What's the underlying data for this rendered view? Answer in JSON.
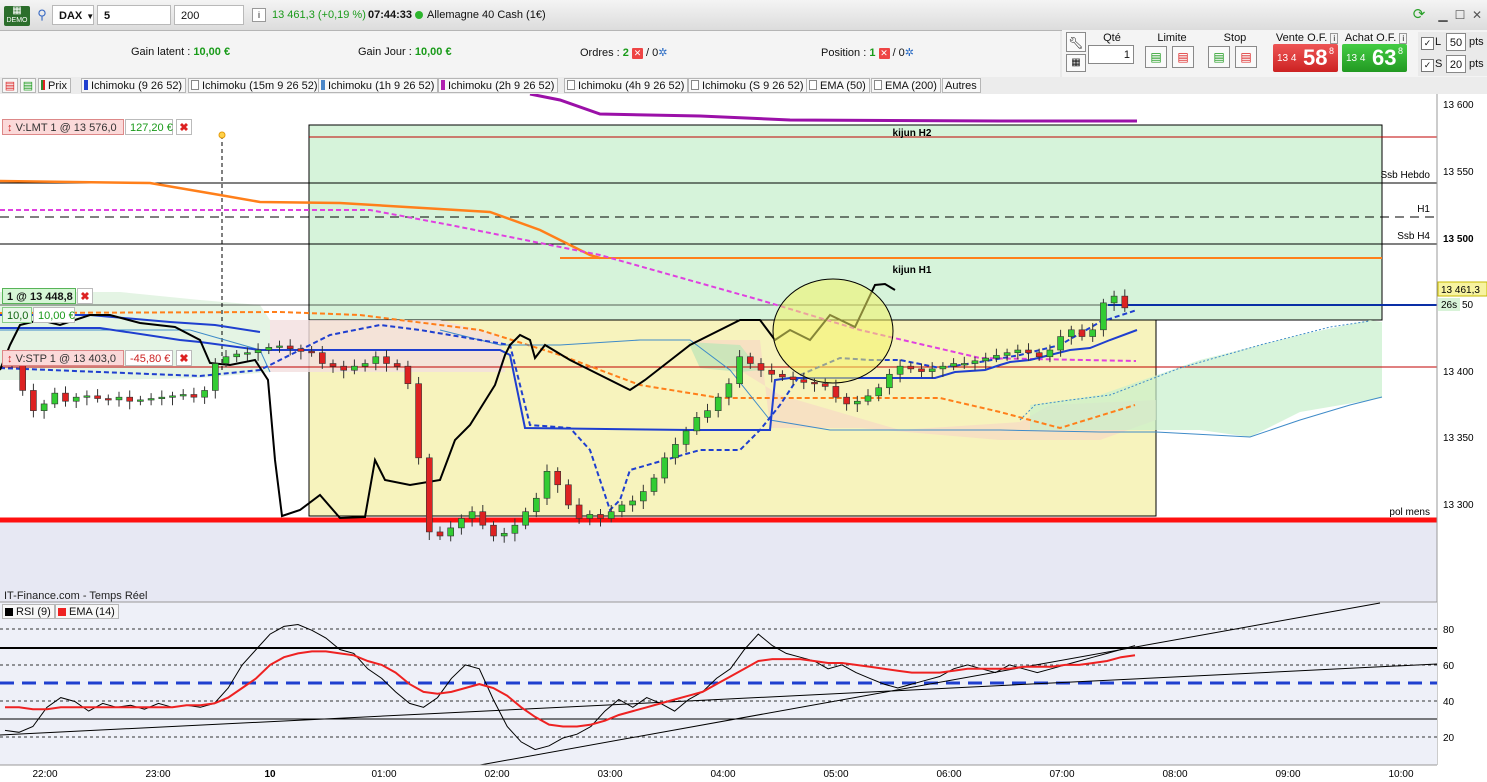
{
  "toolbar": {
    "demo_label": "DEMO",
    "symbol": "DAX",
    "timeframe": "5 minutes",
    "units": "200 unités",
    "info_icon": "i",
    "quote": "13 461,3 (+0,19 %)",
    "time": "07:44:33",
    "instrument": "Allemagne 40 Cash (1€)"
  },
  "info": {
    "gain_latent_label": "Gain latent :",
    "gain_latent_value": "10,00 €",
    "gain_jour_label": "Gain Jour :",
    "gain_jour_value": "10,00 €",
    "ordres_label": "Ordres :",
    "ordres_count": "2",
    "ordres_zero": "/ 0",
    "position_label": "Position :",
    "position_count": "1",
    "position_zero": "/ 0"
  },
  "order_panel": {
    "qty_label": "Qté",
    "qty_value": "1",
    "limite_label": "Limite",
    "stop_label": "Stop",
    "vente_label": "Vente O.F.",
    "achat_label": "Achat O.F.",
    "vente_prefix": "13 4",
    "vente_big": "58",
    "vente_sup": "8",
    "achat_prefix": "13 4",
    "achat_big": "63",
    "achat_sup": "8",
    "l_label": "L",
    "l_value": "50",
    "s_label": "S",
    "s_value": "20",
    "pts1": "pts",
    "pts2": "pts"
  },
  "indicators": [
    {
      "label": "Prix",
      "color": "#2e8b2e"
    },
    {
      "label": "Ichimoku (9 26 52)",
      "color": "#1f3fcf"
    },
    {
      "label": "Ichimoku (15m 9 26 52)",
      "color": "#ffffff"
    },
    {
      "label": "Ichimoku (1h 9 26 52)",
      "color": "#4a86c8"
    },
    {
      "label": "Ichimoku (2h 9 26 52)",
      "color": "#b020b0"
    },
    {
      "label": "Ichimoku (4h 9 26 52)",
      "color": "#ffffff"
    },
    {
      "label": "Ichimoku (S 9 26 52)",
      "color": "#ffffff"
    },
    {
      "label": "EMA (50)",
      "color": "#ffffff"
    },
    {
      "label": "EMA (200)",
      "color": "#ffffff"
    },
    {
      "label": "Autres",
      "color": "none"
    }
  ],
  "orders": {
    "limit_tag": "V:LMT  1 @ 13 576,0",
    "limit_pnl": "127,20 €",
    "position_tag": "1 @ 13 448,8",
    "position_qty": "10,0",
    "position_pnl": "10,00 €",
    "stop_tag": "V:STP  1 @ 13 403,0",
    "stop_pnl": "-45,80 €"
  },
  "annotations": {
    "kijun_h2": "kijun H2",
    "kijun_h1": "kijun H1",
    "ssb_hebdo": "Ssb Hebdo",
    "h1": "H1",
    "ssb_h4": "Ssb H4",
    "pol_mens": "pol mens",
    "last_price": "13 461,3",
    "countdown": "26s"
  },
  "price_axis": [
    "13 600",
    "13 550",
    "13 500",
    "50",
    "13 400",
    "13 350",
    "13 300"
  ],
  "time_axis": [
    "22:00",
    "23:00",
    "10",
    "01:00",
    "02:00",
    "03:00",
    "04:00",
    "05:00",
    "06:00",
    "07:00",
    "08:00",
    "09:00",
    "10:00"
  ],
  "rsi_panel": {
    "source": "IT-Finance.com - Temps Réel",
    "rsi_label": "RSI (9)",
    "ema_label": "EMA (14)",
    "axis": [
      "80",
      "60",
      "40",
      "20"
    ]
  },
  "colors": {
    "candle_up": "#33cc33",
    "candle_down": "#dd2222",
    "tenkan": "#1f3fcf",
    "kijun_h4": "#ff7f1a",
    "ema_magenta": "#e040e0",
    "chikou": "#000000",
    "pol_mens": "#ff1010"
  },
  "chart_data": {
    "type": "candlestick",
    "symbol": "DAX",
    "timeframe": "5 minutes",
    "last": 13461.3,
    "change_pct": 0.19,
    "y_range": [
      13270,
      13620
    ],
    "levels": {
      "kijun_h2": 13576,
      "ssb_hebdo": 13543,
      "h1": 13516,
      "ssb_h4": 13494,
      "kijun_h1": 13485,
      "position": 13448.8,
      "stop": 13403,
      "pol_mens": 13288
    },
    "closes": [
      13420,
      13400,
      13385,
      13390,
      13398,
      13392,
      13395,
      13396,
      13394,
      13393,
      13395,
      13392,
      13393,
      13394,
      13395,
      13396,
      13397,
      13395,
      13400,
      13420,
      13425,
      13427,
      13428,
      13430,
      13432,
      13433,
      13431,
      13429,
      13428,
      13420,
      13418,
      13415,
      13418,
      13420,
      13425,
      13420,
      13418,
      13405,
      13350,
      13295,
      13292,
      13298,
      13305,
      13310,
      13300,
      13292,
      13294,
      13300,
      13310,
      13320,
      13340,
      13330,
      13315,
      13305,
      13308,
      13305,
      13310,
      13315,
      13318,
      13325,
      13335,
      13350,
      13360,
      13370,
      13380,
      13385,
      13395,
      13405,
      13425,
      13420,
      13415,
      13412,
      13410,
      13408,
      13406,
      13405,
      13403,
      13395,
      13390,
      13392,
      13396,
      13402,
      13412,
      13418,
      13416,
      13414,
      13416,
      13418,
      13420,
      13420,
      13422,
      13424,
      13426,
      13428,
      13430,
      13428,
      13425,
      13430,
      13440,
      13445,
      13440,
      13445,
      13465,
      13470,
      13461.3
    ]
  },
  "rsi_data": {
    "type": "line",
    "y_range": [
      10,
      90
    ],
    "rsi": [
      28,
      27,
      30,
      40,
      45,
      43,
      38,
      42,
      40,
      41,
      39,
      42,
      40,
      41,
      40,
      42,
      50,
      62,
      70,
      78,
      82,
      83,
      80,
      76,
      70,
      68,
      60,
      55,
      48,
      42,
      40,
      45,
      55,
      62,
      60,
      44,
      30,
      22,
      18,
      20,
      24,
      26,
      30,
      38,
      44,
      40,
      45,
      42,
      38,
      44,
      48,
      55,
      60,
      70,
      78,
      72,
      68,
      66,
      64,
      60,
      62,
      58,
      55,
      52,
      50,
      52,
      54,
      56,
      60,
      62,
      60,
      58,
      62,
      60,
      58,
      60,
      62,
      64,
      66,
      68,
      70,
      72
    ],
    "ema": [
      40,
      40,
      39,
      39,
      40,
      40,
      40,
      40,
      40,
      40,
      40,
      40,
      40,
      41,
      41,
      42,
      45,
      50,
      55,
      62,
      66,
      68,
      69,
      69,
      68,
      67,
      64,
      62,
      58,
      52,
      48,
      47,
      48,
      50,
      52,
      50,
      46,
      40,
      35,
      31,
      30,
      30,
      31,
      33,
      36,
      38,
      40,
      42,
      44,
      46,
      48,
      52,
      56,
      60,
      64,
      65,
      65,
      65,
      64,
      63,
      63,
      62,
      61,
      60,
      59,
      58,
      58,
      58,
      59,
      60,
      60,
      60,
      60,
      61,
      61,
      61,
      62,
      62,
      63,
      64,
      66,
      67
    ]
  }
}
